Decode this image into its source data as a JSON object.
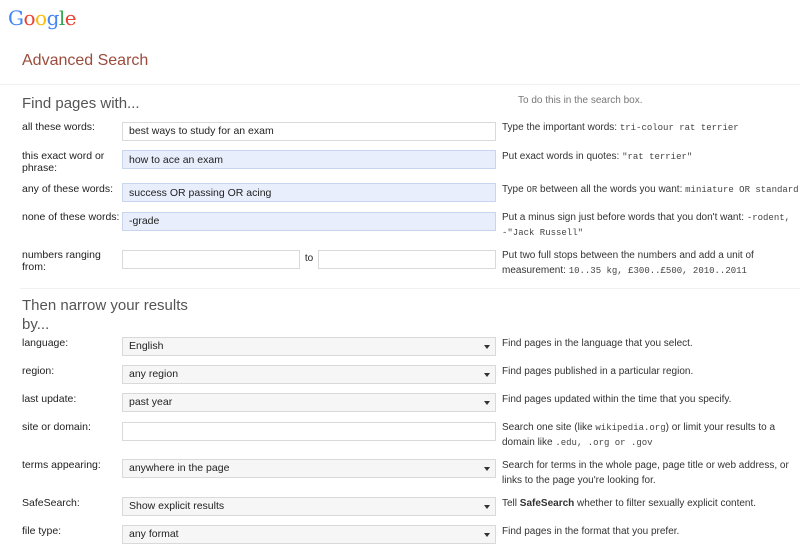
{
  "brand": {
    "logo_letters": [
      {
        "char": "G",
        "color": "#4285f4"
      },
      {
        "char": "o",
        "color": "#ea4335"
      },
      {
        "char": "o",
        "color": "#fbbc05"
      },
      {
        "char": "g",
        "color": "#4285f4"
      },
      {
        "char": "l",
        "color": "#34a853"
      },
      {
        "char": "e",
        "color": "#ea4335"
      }
    ]
  },
  "page": {
    "title": "Advanced Search"
  },
  "section1": {
    "heading": "Find pages with...",
    "help_heading": "To do this in the search box.",
    "rows": [
      {
        "label": "all these words:",
        "value": "best ways to study for an exam",
        "filled": false,
        "help_pre": "Type the important words: ",
        "help_mono": "tri-colour rat terrier",
        "help_post": ""
      },
      {
        "label": "this exact word or phrase:",
        "value": "how to ace an exam",
        "filled": true,
        "help_pre": "Put exact words in quotes: ",
        "help_mono": "\"rat terrier\"",
        "help_post": ""
      },
      {
        "label": "any of these words:",
        "value": "success OR passing OR acing",
        "filled": true,
        "help_pre": "Type ",
        "help_mono": "OR",
        "help_post": " between all the words you want: ",
        "help_mono2": "miniature OR standard"
      },
      {
        "label": "none of these words:",
        "value": "-grade",
        "filled": true,
        "help_pre": "Put a minus sign just before words that you don't want: ",
        "help_mono": "-rodent, -\"Jack Russell\"",
        "help_post": ""
      }
    ],
    "range_row": {
      "label": "numbers ranging from:",
      "from_value": "",
      "to_label": "to",
      "to_value": "",
      "help_pre": "Put two full stops between the numbers and add a unit of measurement: ",
      "help_mono": "10..35 kg, £300..£500, 2010..2011"
    }
  },
  "section2": {
    "heading": "Then narrow your results by...",
    "rows": [
      {
        "label": "language:",
        "type": "select",
        "value": "English",
        "help": "Find pages in the language that you select."
      },
      {
        "label": "region:",
        "type": "select",
        "value": "any region",
        "help": "Find pages published in a particular region."
      },
      {
        "label": "last update:",
        "type": "select",
        "value": "past year",
        "help": "Find pages updated within the time that you specify."
      },
      {
        "label": "site or domain:",
        "type": "text",
        "value": "",
        "help_pre": "Search one site (like ",
        "help_mono": "wikipedia.org",
        "help_mid": ") or limit your results to a domain like ",
        "help_mono2": ".edu, .org or .gov"
      },
      {
        "label": "terms appearing:",
        "type": "select",
        "value": "anywhere in the page",
        "help": "Search for terms in the whole page, page title or web address, or links to the page you're looking for."
      },
      {
        "label": "SafeSearch:",
        "type": "select",
        "value": "Show explicit results",
        "help_pre": "Tell ",
        "help_bold": "SafeSearch",
        "help_post": " whether to filter sexually explicit content."
      },
      {
        "label": "file type:",
        "type": "select",
        "value": "any format",
        "help": "Find pages in the format that you prefer."
      }
    ]
  }
}
